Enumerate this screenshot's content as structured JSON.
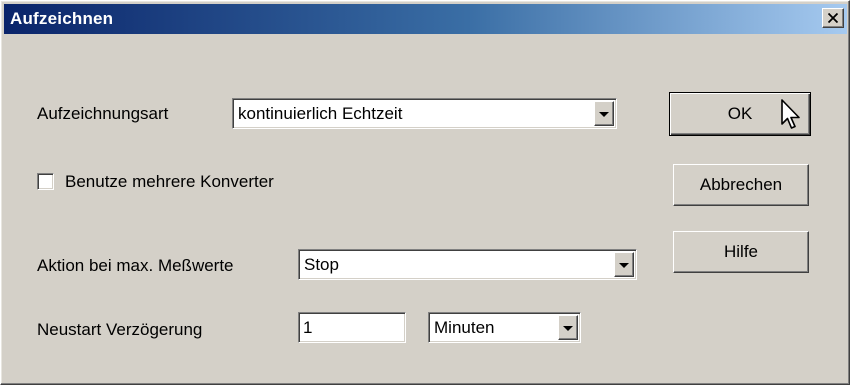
{
  "window": {
    "title": "Aufzeichnen",
    "close_icon": "close-icon"
  },
  "form": {
    "recording_type": {
      "label": "Aufzeichnungsart",
      "value": "kontinuierlich Echtzeit"
    },
    "multiple_converters": {
      "label": "Benutze mehrere Konverter",
      "checked": false
    },
    "max_values_action": {
      "label": "Aktion bei max. Meßwerte",
      "value": "Stop"
    },
    "restart_delay": {
      "label": "Neustart Verzögerung",
      "value": "1",
      "unit": "Minuten"
    }
  },
  "buttons": {
    "ok": "OK",
    "cancel": "Abbrechen",
    "help": "Hilfe"
  },
  "colors": {
    "face": "#d4d0c8",
    "title_start": "#0a246a",
    "title_end": "#a6caf0"
  }
}
